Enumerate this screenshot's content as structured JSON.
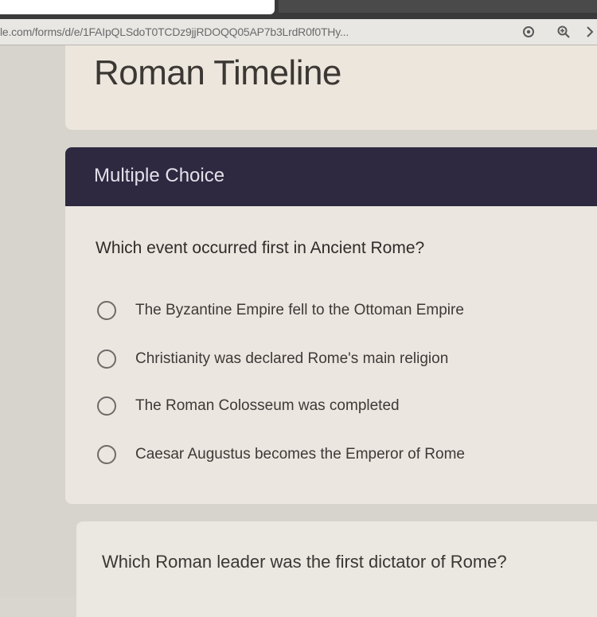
{
  "browser": {
    "url": "le.com/forms/d/e/1FAIpQLSdoT0TCDz9jjRDOQQ05AP7b3LrdR0f0THy..."
  },
  "form": {
    "title": "Roman Timeline"
  },
  "section": {
    "title": "Multiple Choice",
    "question": "Which event occurred first in Ancient Rome?",
    "options": [
      "The Byzantine Empire fell to the Ottoman Empire",
      "Christianity was declared Rome's main religion",
      "The Roman Colosseum was completed",
      "Caesar Augustus becomes the Emperor of Rome"
    ]
  },
  "next_question": {
    "text": "Which Roman leader was the first dictator of Rome?"
  },
  "icons": {
    "location": "location-icon",
    "zoom": "zoom-icon",
    "extension": "extension-icon"
  },
  "colors": {
    "header": "#2e2940",
    "card": "#ebe6e0"
  }
}
